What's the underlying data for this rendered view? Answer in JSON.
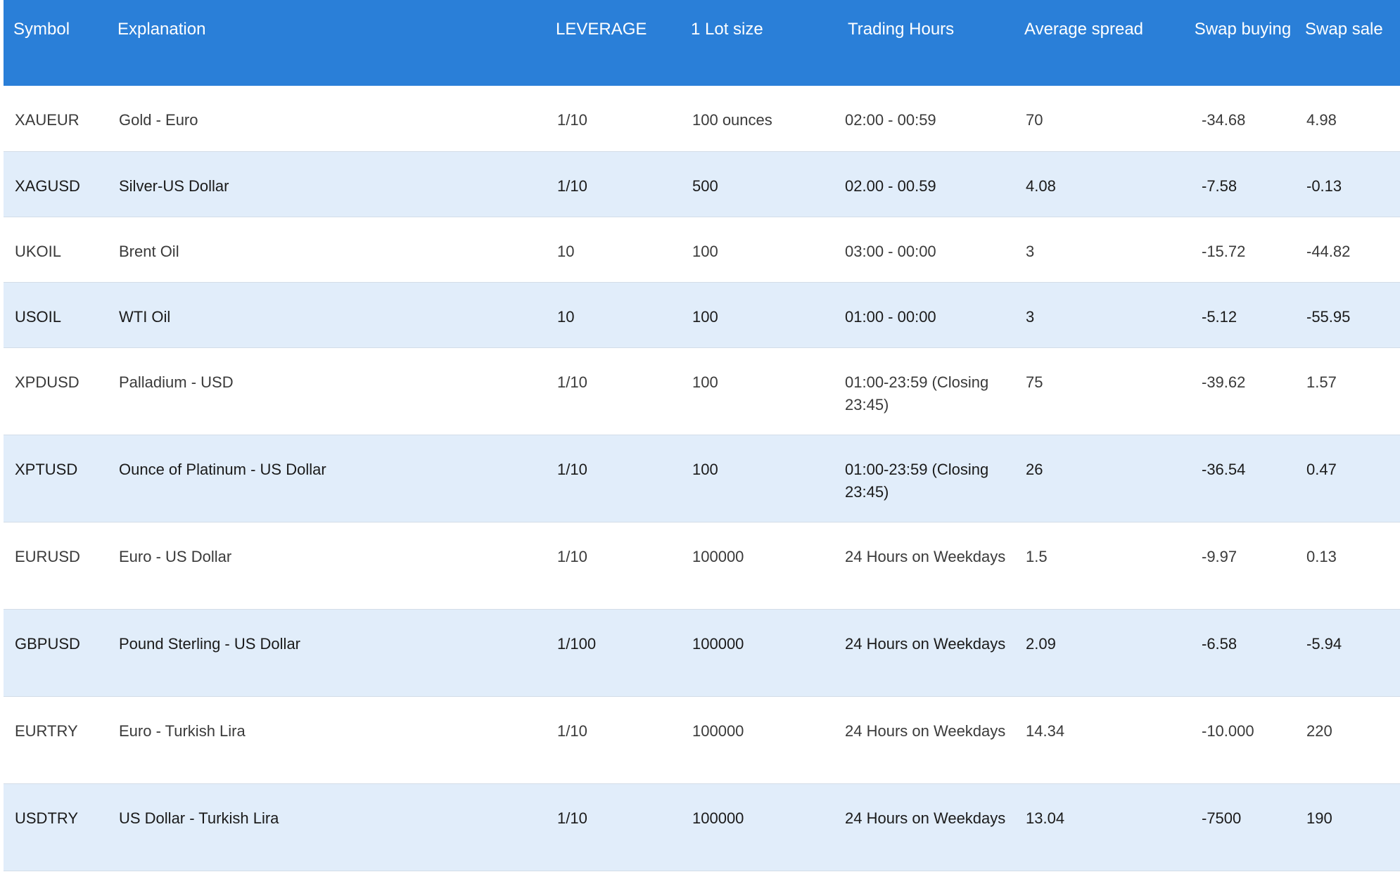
{
  "table": {
    "headers": [
      "Symbol",
      "Explanation",
      "LEVERAGE",
      "1 Lot size",
      "Trading Hours",
      "Average spread",
      "Swap buying",
      "Swap sale"
    ],
    "rows": [
      [
        "XAUEUR",
        "Gold - Euro",
        "1/10",
        "100 ounces",
        "02:00 - 00:59",
        "70",
        "-34.68",
        "4.98"
      ],
      [
        "XAGUSD",
        "Silver-US Dollar",
        "1/10",
        "500",
        "02.00 - 00.59",
        "4.08",
        "-7.58",
        "-0.13"
      ],
      [
        "UKOIL",
        "Brent Oil",
        "10",
        "100",
        "03:00 - 00:00",
        "3",
        "-15.72",
        "-44.82"
      ],
      [
        "USOIL",
        "WTI Oil",
        "10",
        "100",
        "01:00 - 00:00",
        "3",
        "-5.12",
        "-55.95"
      ],
      [
        "XPDUSD",
        "Palladium - USD",
        "1/10",
        "100",
        "01:00-23:59 (Closing 23:45)",
        "75",
        "-39.62",
        "1.57"
      ],
      [
        "XPTUSD",
        "Ounce of Platinum - US Dollar",
        "1/10",
        "100",
        "01:00-23:59 (Closing 23:45)",
        "26",
        "-36.54",
        "0.47"
      ],
      [
        "EURUSD",
        "Euro - US Dollar",
        "1/10",
        "100000",
        "24 Hours on Weekdays",
        "1.5",
        "-9.97",
        "0.13"
      ],
      [
        "GBPUSD",
        "Pound Sterling - US Dollar",
        "1/100",
        "100000",
        "24 Hours on Weekdays",
        "2.09",
        "-6.58",
        "-5.94"
      ],
      [
        "EURTRY",
        "Euro - Turkish Lira",
        "1/10",
        "100000",
        "24 Hours on Weekdays",
        "14.34",
        "-10.000",
        "220"
      ],
      [
        "USDTRY",
        "US Dollar - Turkish Lira",
        "1/10",
        "100000",
        "24 Hours on Weekdays",
        "13.04",
        "-7500",
        "190"
      ]
    ]
  }
}
